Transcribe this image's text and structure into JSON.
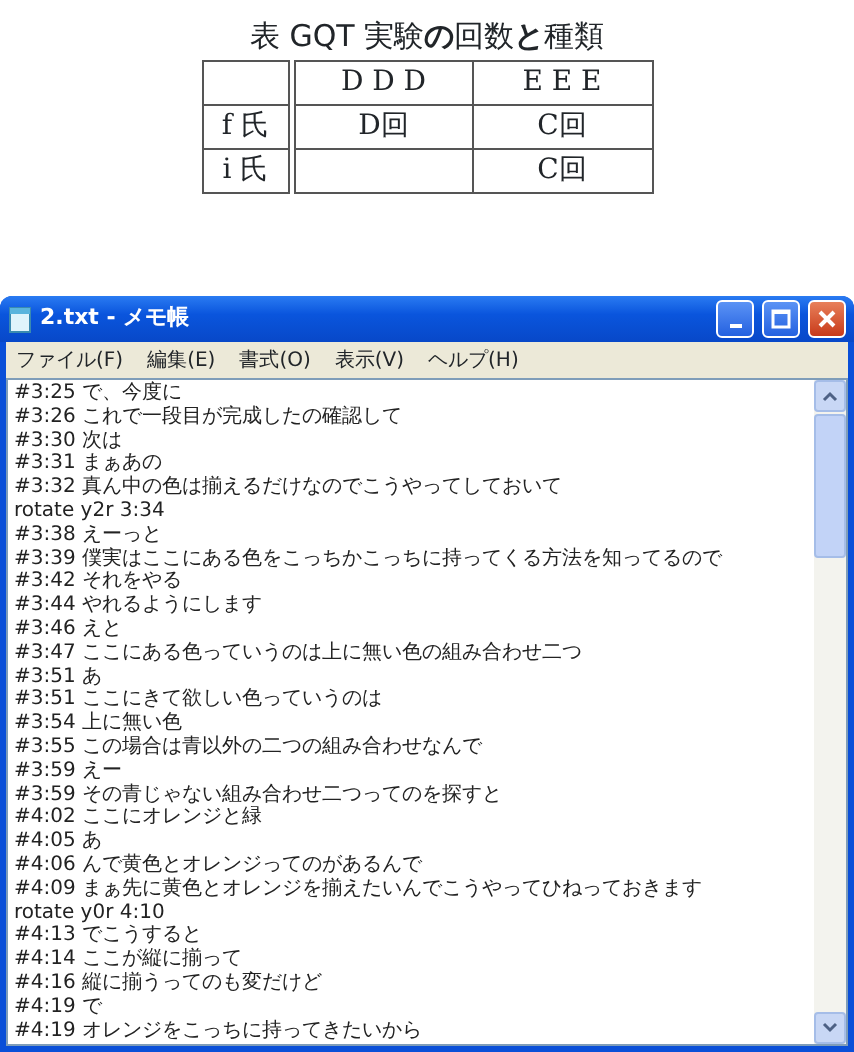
{
  "figure": {
    "caption": "表 GQT 実験**の**回数**と**種類",
    "header": [
      "D D D",
      "E E E"
    ],
    "rows": [
      [
        "f 氏",
        "D回",
        "C回"
      ],
      [
        "i 氏",
        "",
        "C回"
      ]
    ]
  },
  "window": {
    "title": "2.txt - メモ帳",
    "menu": [
      "ファイル(F)",
      "編集(E)",
      "書式(O)",
      "表示(V)",
      "ヘルプ(H)"
    ],
    "lines": [
      "#3:25 で、今度に",
      "#3:26 これで一段目が完成したの確認して",
      "#3:30 次は",
      "#3:31 まぁあの",
      "#3:32 真ん中の色は揃えるだけなのでこうやってしておいて",
      "rotate y2r 3:34",
      "#3:38 えーっと",
      "#3:39 僕実はここにある色をこっちかこっちに持ってくる方法を知ってるので",
      "#3:42 それをやる",
      "#3:44 やれるようにします",
      "#3:46 えと",
      "#3:47 ここにある色っていうのは上に無い色の組み合わせ二つ",
      "#3:51 あ",
      "#3:51 ここにきて欲しい色っていうのは",
      "#3:54 上に無い色",
      "#3:55 この場合は青以外の二つの組み合わせなんで",
      "#3:59 えー",
      "#3:59 その青じゃない組み合わせ二つってのを探すと",
      "#4:02 ここにオレンジと緑",
      "#4:05 あ",
      "#4:06 んで黄色とオレンジってのがあるんで",
      "#4:09 まぁ先に黄色とオレンジを揃えたいんでこうやってひねっておきます",
      "rotate y0r 4:10",
      "#4:13 でこうすると",
      "#4:14 ここが縦に揃って",
      "#4:16 縦に揃うってのも変だけど",
      "#4:19 で",
      "#4:19 オレンジをこっちに持ってきたいから"
    ]
  }
}
